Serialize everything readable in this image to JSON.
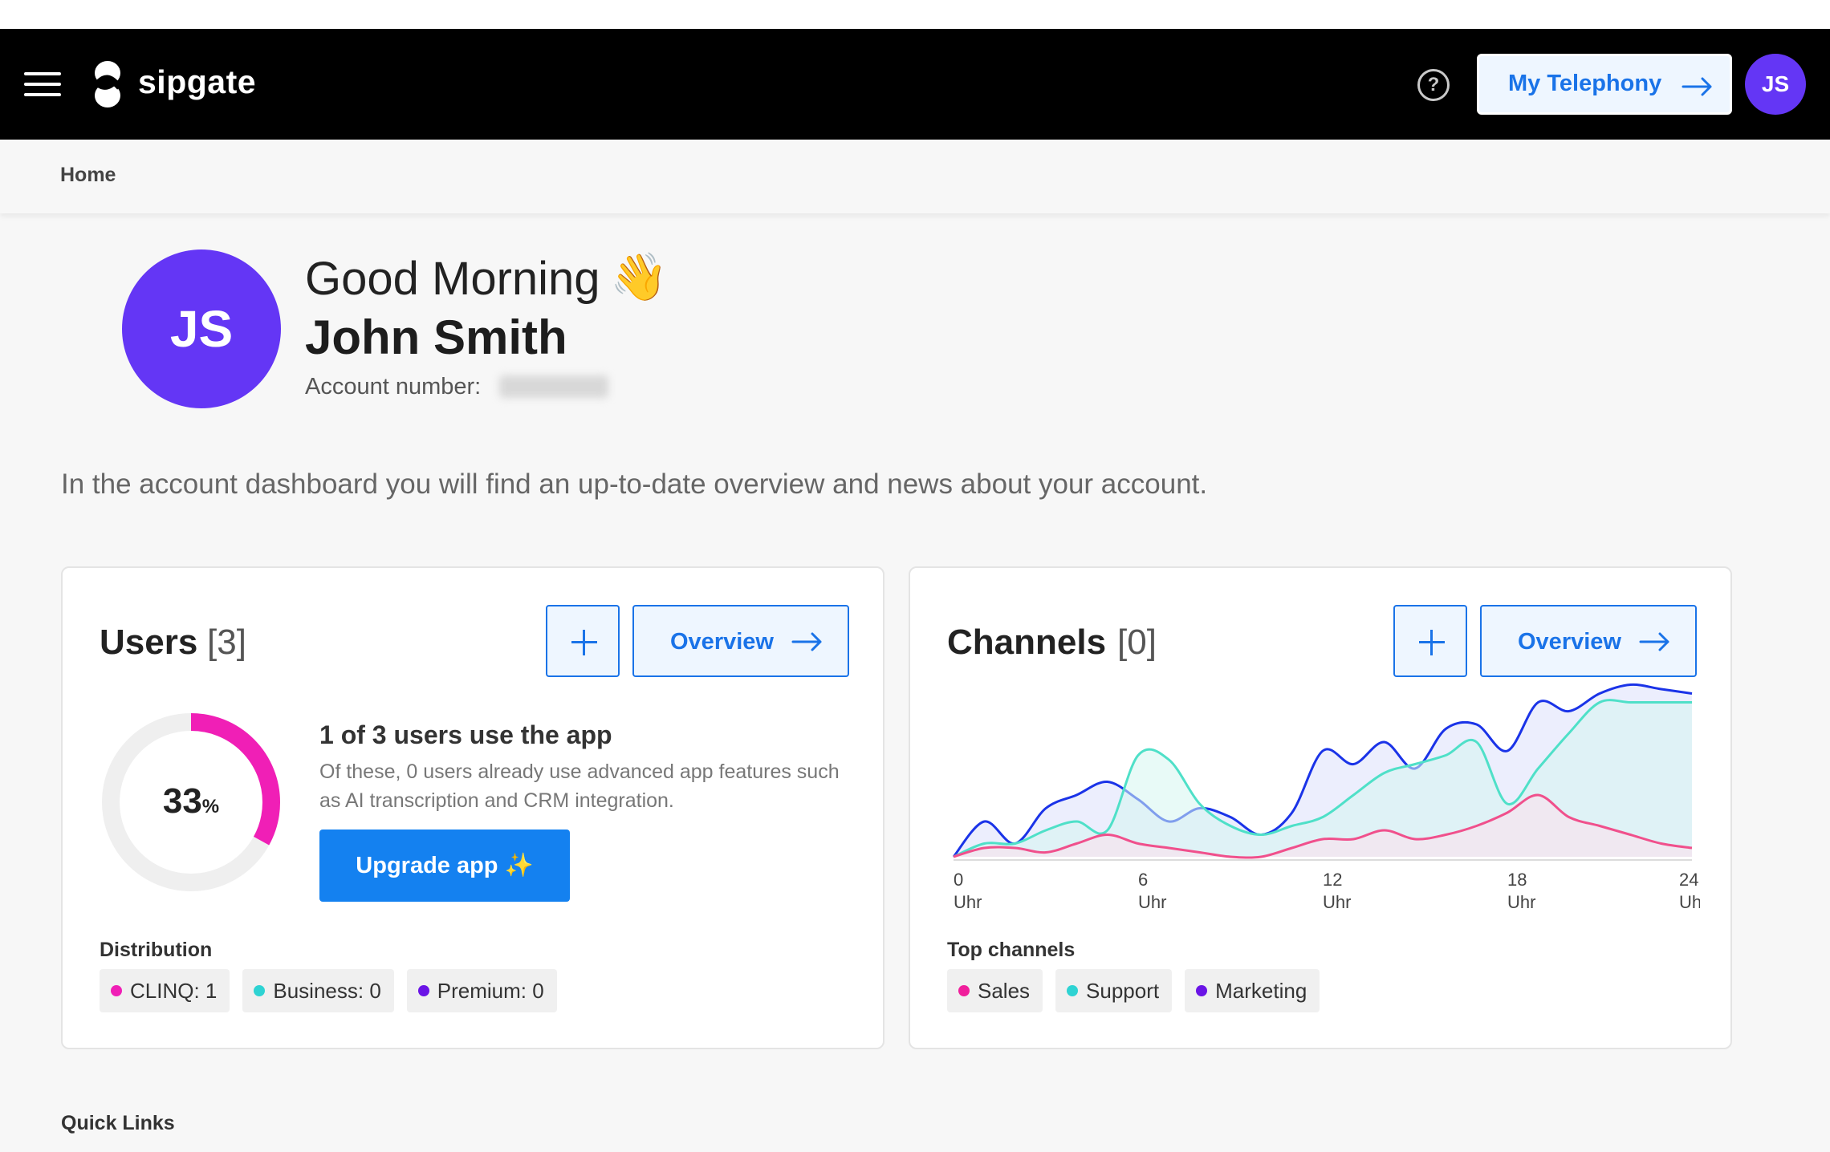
{
  "header": {
    "brand": "sipgate",
    "help_label": "?",
    "telephony_button": "My Telephony",
    "avatar_initials": "JS"
  },
  "breadcrumb": {
    "home": "Home"
  },
  "profile": {
    "initials": "JS",
    "greeting": "Good Morning",
    "wave_emoji": "👋",
    "name": "John Smith",
    "account_label": "Account number:"
  },
  "intro": "In the account dashboard you will find an up-to-date overview and news about your account.",
  "users_card": {
    "title": "Users",
    "count": "[3]",
    "overview_label": "Overview",
    "percent": "33",
    "percent_unit": "%",
    "percent_fraction": 0.33,
    "app_title": "1 of 3 users use the app",
    "app_desc": "Of these, 0 users already use advanced app features such as AI transcription and CRM integration.",
    "upgrade_label": "Upgrade app",
    "upgrade_icon": "✨",
    "distribution_label": "Distribution",
    "chips": [
      {
        "label": "CLINQ: 1",
        "color": "#f01fb6"
      },
      {
        "label": "Business: 0",
        "color": "#2ed3d3"
      },
      {
        "label": "Premium: 0",
        "color": "#6a14e6"
      }
    ]
  },
  "channels_card": {
    "title": "Channels",
    "count": "[0]",
    "overview_label": "Overview",
    "top_label": "Top channels",
    "chips": [
      {
        "label": "Sales",
        "color": "#f01f9c"
      },
      {
        "label": "Support",
        "color": "#2ed3d3"
      },
      {
        "label": "Marketing",
        "color": "#6a14e6"
      }
    ]
  },
  "chart_data": {
    "type": "area",
    "x": [
      0,
      1,
      2,
      3,
      4,
      5,
      6,
      7,
      8,
      9,
      10,
      11,
      12,
      13,
      14,
      15,
      16,
      17,
      18,
      19,
      20,
      21,
      22,
      23,
      24
    ],
    "x_tick_labels": [
      {
        "x": 0,
        "line1": "0",
        "line2": "Uhr"
      },
      {
        "x": 6,
        "line1": "6",
        "line2": "Uhr"
      },
      {
        "x": 12,
        "line1": "12",
        "line2": "Uhr"
      },
      {
        "x": 18,
        "line1": "18",
        "line2": "Uhr"
      },
      {
        "x": 24,
        "line1": "24",
        "line2": "Uhr"
      }
    ],
    "series": [
      {
        "color": "#1a33e8",
        "fill": "#dce0fb",
        "values": [
          0,
          16,
          6,
          22,
          28,
          34,
          26,
          16,
          22,
          18,
          10,
          20,
          48,
          42,
          52,
          40,
          58,
          60,
          48,
          70,
          66,
          74,
          78,
          76,
          74
        ]
      },
      {
        "color": "#4fe0c8",
        "fill": "#d6f5f1",
        "values": [
          0,
          6,
          6,
          12,
          16,
          12,
          46,
          44,
          24,
          14,
          10,
          14,
          18,
          28,
          38,
          42,
          46,
          52,
          24,
          40,
          56,
          70,
          70,
          70,
          70
        ]
      },
      {
        "color": "#f0508c",
        "fill": "#fde0ec",
        "values": [
          0,
          4,
          4,
          2,
          6,
          10,
          6,
          4,
          2,
          0,
          0,
          4,
          8,
          8,
          12,
          8,
          10,
          14,
          20,
          28,
          18,
          14,
          10,
          6,
          4
        ]
      }
    ],
    "ylim": [
      0,
      80
    ],
    "grid": false
  }
}
